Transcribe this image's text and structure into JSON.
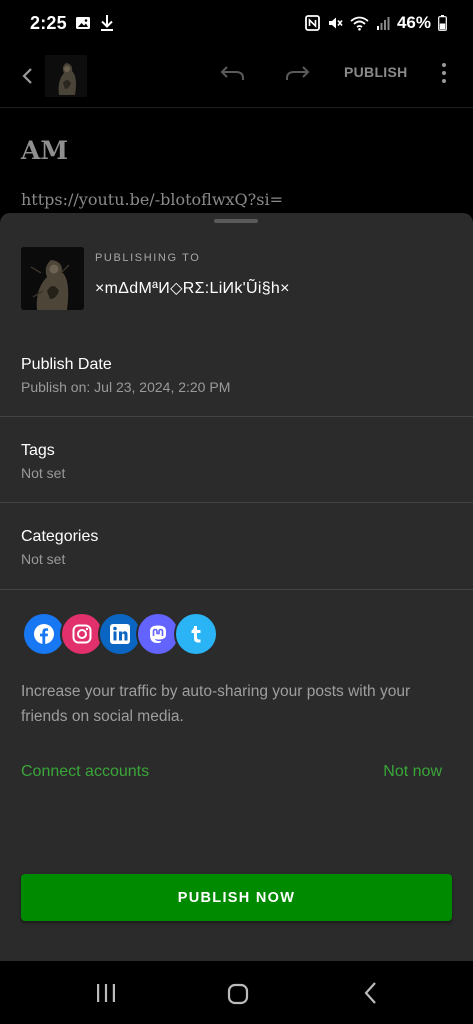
{
  "status_bar": {
    "time": "2:25",
    "battery": "46%",
    "icons_left": [
      "image-icon",
      "download-icon"
    ],
    "icons_right": [
      "nfc-icon",
      "mute-icon",
      "wifi-icon",
      "signal-icon",
      "battery-icon"
    ]
  },
  "toolbar": {
    "publish_label": "PUBLISH",
    "icons": [
      "back-arrow-icon",
      "undo-icon",
      "redo-icon",
      "more-vertical-icon"
    ]
  },
  "editor": {
    "title": "AM",
    "body": "https://youtu.be/-blotoflwxQ?si="
  },
  "sheet": {
    "caption": "PUBLISHING TO",
    "site_name": "×mΔdMªИ◇RΣ:LiИk'Ũi§h×",
    "publish_date": {
      "title": "Publish Date",
      "value": "Publish on: Jul 23, 2024, 2:20 PM"
    },
    "tags": {
      "title": "Tags",
      "value": "Not set"
    },
    "categories": {
      "title": "Categories",
      "value": "Not set"
    },
    "social": {
      "networks": [
        {
          "name": "facebook",
          "color": "#1877F2",
          "glyph": "f"
        },
        {
          "name": "instagram",
          "color": "#E1306C",
          "glyph": ""
        },
        {
          "name": "linkedin",
          "color": "#0A66C2",
          "glyph": "in"
        },
        {
          "name": "mastodon",
          "color": "#6364FF",
          "glyph": "m"
        },
        {
          "name": "tumblr",
          "color": "#2ab4f5",
          "glyph": "t"
        }
      ],
      "text": "Increase your traffic by auto-sharing your posts with your friends on social media.",
      "connect_label": "Connect accounts",
      "not_now_label": "Not now"
    },
    "publish_now_label": "PUBLISH NOW"
  },
  "colors": {
    "accent_green": "#008a00",
    "link_green": "#3aa63a",
    "sheet_bg": "#2b2b2b"
  },
  "navbar": {
    "icons": [
      "recents-icon",
      "home-icon",
      "back-icon"
    ]
  }
}
